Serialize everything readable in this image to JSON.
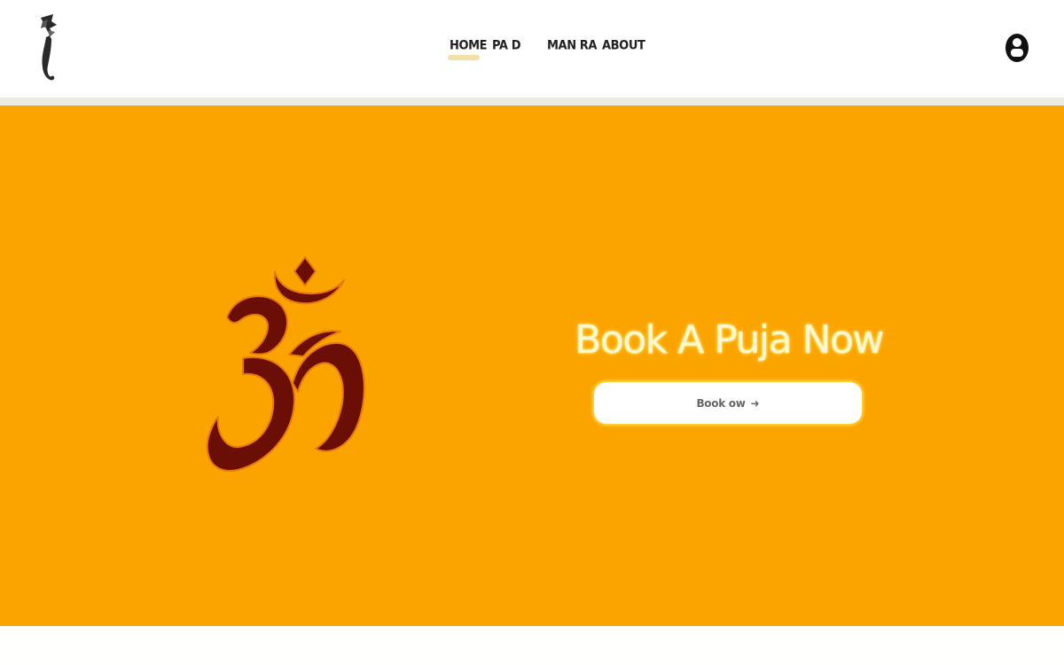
{
  "header": {
    "nav": [
      {
        "label": "HOME",
        "active": true
      },
      {
        "label": "PA D"
      },
      {
        "label": "MAN RA"
      },
      {
        "label": "ABOUT"
      }
    ],
    "logo_icon": "ganesha-trunk-logo",
    "user_icon": "user-account-icon"
  },
  "hero": {
    "background": "#fba400",
    "symbol_icon": "om-symbol-icon",
    "title": "Book A Puja Now",
    "button_label": "Book  ow",
    "button_icon": "arrow-right-icon"
  },
  "colors": {
    "accent": "#fba400",
    "om": "#6b0f06",
    "title_glow": "#ffee7a",
    "nav_active_underline": "#f4dfa6"
  }
}
